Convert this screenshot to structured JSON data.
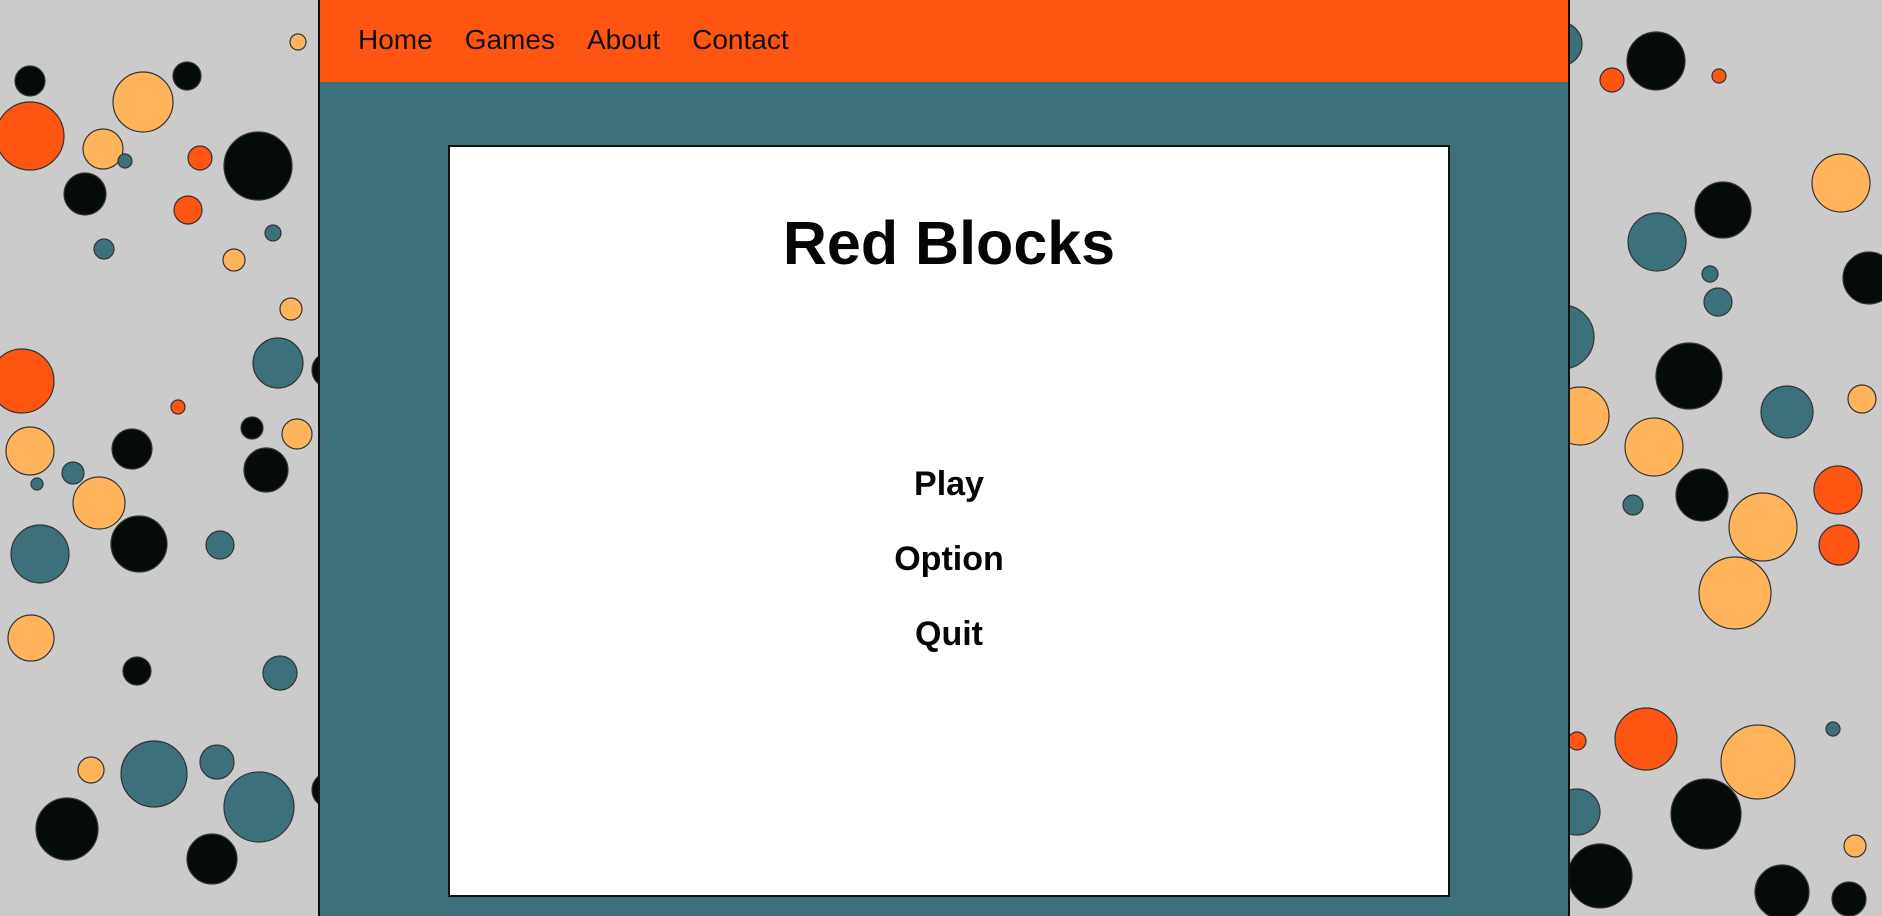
{
  "nav": {
    "items": [
      {
        "label": "Home"
      },
      {
        "label": "Games"
      },
      {
        "label": "About"
      },
      {
        "label": "Contact"
      }
    ]
  },
  "game": {
    "title": "Red Blocks",
    "menu": [
      {
        "label": "Play"
      },
      {
        "label": "Option"
      },
      {
        "label": "Quit"
      }
    ]
  },
  "colors": {
    "background": "#cbcbcb",
    "navbar": "#ff5513",
    "frame": "#3c717c",
    "panel": "#ffffff",
    "dot_colors": [
      "#ff5513",
      "#ffb35b",
      "#050c08",
      "#3c717c"
    ]
  }
}
